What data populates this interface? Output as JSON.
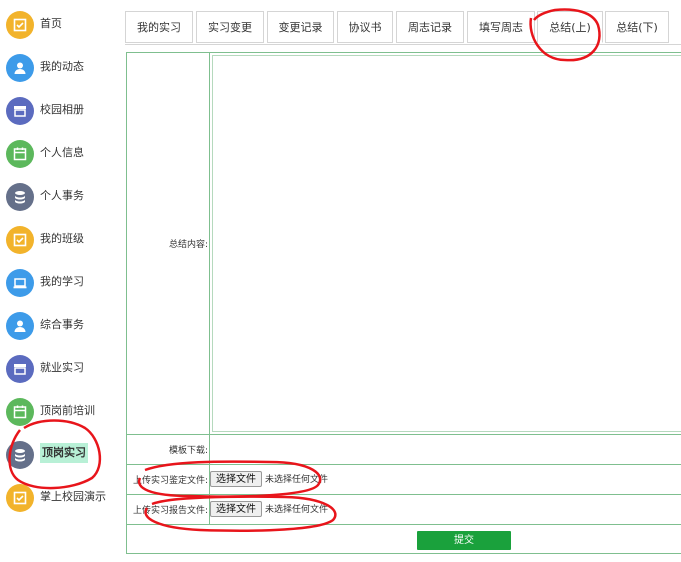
{
  "sidebar": {
    "items": [
      {
        "label": "首页",
        "icon": "check-square-icon",
        "color": "#f2b32b"
      },
      {
        "label": "我的动态",
        "icon": "user-icon",
        "color": "#3d9be9"
      },
      {
        "label": "校园相册",
        "icon": "store-icon",
        "color": "#5b6bbf"
      },
      {
        "label": "个人信息",
        "icon": "calendar-icon",
        "color": "#5cb85c"
      },
      {
        "label": "个人事务",
        "icon": "database-icon",
        "color": "#65708a"
      },
      {
        "label": "我的班级",
        "icon": "check-square-icon",
        "color": "#f2b32b"
      },
      {
        "label": "我的学习",
        "icon": "laptop-icon",
        "color": "#3d9be9"
      },
      {
        "label": "综合事务",
        "icon": "user-icon",
        "color": "#3d9be9"
      },
      {
        "label": "就业实习",
        "icon": "store-icon",
        "color": "#5b6bbf"
      },
      {
        "label": "顶岗前培训",
        "icon": "calendar-icon",
        "color": "#5cb85c"
      },
      {
        "label": "顶岗实习",
        "icon": "database-icon",
        "color": "#65708a"
      },
      {
        "label": "掌上校园演示",
        "icon": "check-square-icon",
        "color": "#f2b32b"
      }
    ]
  },
  "tabs": [
    "我的实习",
    "实习变更",
    "变更记录",
    "协议书",
    "周志记录",
    "填写周志",
    "总结(上)",
    "总结(下)"
  ],
  "form": {
    "summary_label": "总结内容:",
    "template_label": "模板下载:",
    "appraisal_label": "上传实习鉴定文件:",
    "report_label": "上传实习报告文件:",
    "choose_file": "选择文件",
    "no_file": "未选择任何文件",
    "submit": "提交"
  },
  "colors": {
    "accent": "#1aa13c",
    "border": "#7fbf8f",
    "active_bg": "#b8f0d6",
    "annotation": "#e8151b"
  }
}
